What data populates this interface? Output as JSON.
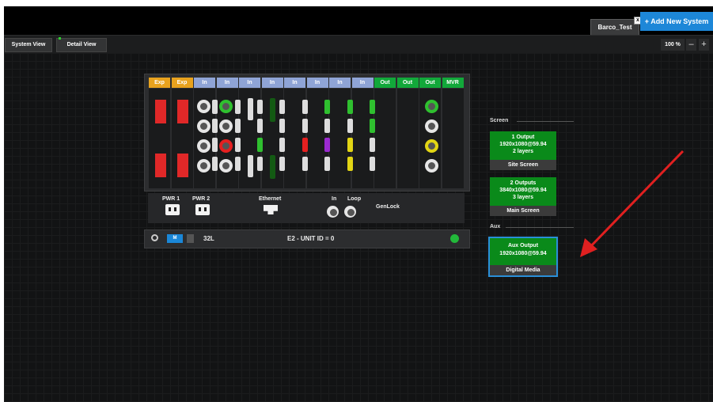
{
  "header": {
    "system_tab_label": "Barco_Test",
    "system_tab_close": "x",
    "add_system_label": "+ Add New System"
  },
  "toolbar": {
    "system_view_label": "System View",
    "detail_view_label": "Detail View",
    "zoom_value": "100 %",
    "zoom_out_label": "–",
    "zoom_in_label": "+"
  },
  "chassis": {
    "slots": [
      {
        "label": "Exp",
        "color": "#e8a21e"
      },
      {
        "label": "Exp",
        "color": "#e8a21e"
      },
      {
        "label": "In",
        "color": "#8fa4d6"
      },
      {
        "label": "In",
        "color": "#8fa4d6"
      },
      {
        "label": "In",
        "color": "#8fa4d6"
      },
      {
        "label": "In",
        "color": "#8fa4d6"
      },
      {
        "label": "In",
        "color": "#8fa4d6"
      },
      {
        "label": "In",
        "color": "#8fa4d6"
      },
      {
        "label": "In",
        "color": "#8fa4d6"
      },
      {
        "label": "In",
        "color": "#8fa4d6"
      },
      {
        "label": "Out",
        "color": "#12a83a"
      },
      {
        "label": "Out",
        "color": "#12a83a"
      },
      {
        "label": "Out",
        "color": "#12a83a"
      },
      {
        "label": "MVR",
        "color": "#12a83a"
      }
    ],
    "pwr1_label": "PWR 1",
    "pwr2_label": "PWR 2",
    "ethernet_label": "Ethernet",
    "genlock_in_label": "In",
    "genlock_loop_label": "Loop",
    "genlock_label": "GenLock",
    "mode_badge": "M",
    "model": "32L",
    "unit_id_text": "E2 - UNIT ID = 0",
    "status_color": "#22b83a"
  },
  "destinations": {
    "screen_section_label": "Screen",
    "aux_section_label": "Aux",
    "screens": [
      {
        "lines": [
          "1 Output",
          "1920x1080@59.94",
          "2 layers"
        ],
        "name": "Site Screen"
      },
      {
        "lines": [
          "2 Outputs",
          "3840x1080@59.94",
          "3 layers"
        ],
        "name": "Main Screen"
      }
    ],
    "aux": [
      {
        "lines": [
          "Aux Output",
          "1920x1080@59.94"
        ],
        "name": "Digital Media"
      }
    ]
  },
  "annotation_color": "#e02020"
}
